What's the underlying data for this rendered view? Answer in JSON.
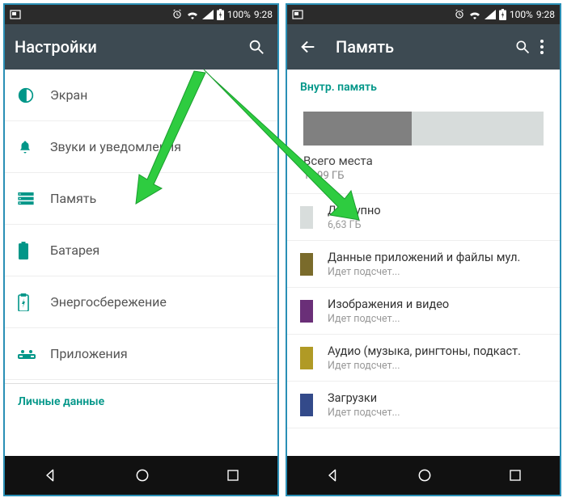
{
  "status": {
    "battery_pct": "100%",
    "time": "9:28"
  },
  "left": {
    "appbar_title": "Настройки",
    "items": [
      {
        "icon": "display-icon",
        "label": "Экран"
      },
      {
        "icon": "bell-icon",
        "label": "Звуки и уведомления"
      },
      {
        "icon": "storage-icon",
        "label": "Память"
      },
      {
        "icon": "battery-icon",
        "label": "Батарея"
      },
      {
        "icon": "battery-saver-icon",
        "label": "Энергосбережение"
      },
      {
        "icon": "apps-icon",
        "label": "Приложения"
      }
    ],
    "section_header": "Личные данные"
  },
  "right": {
    "appbar_title": "Память",
    "section_header": "Внутр. память",
    "used_fraction": 0.45,
    "summary_title": "Всего места",
    "summary_value": "11,99 ГБ",
    "categories": [
      {
        "swatch": "#d8dddc",
        "title": "Доступно",
        "value": "6,63 ГБ"
      },
      {
        "swatch": "#7a6b2b",
        "title": "Данные приложений и файлы мул.",
        "value": "Идет подсчет..."
      },
      {
        "swatch": "#6a2f78",
        "title": "Изображения и видео",
        "value": "Идет подсчет..."
      },
      {
        "swatch": "#b09a25",
        "title": "Аудио (музыка, рингтоны, подкаст.",
        "value": "Идет подсчет..."
      },
      {
        "swatch": "#334a8a",
        "title": "Загрузки",
        "value": "Идет подсчет..."
      }
    ]
  },
  "colors": {
    "accent": "#009688"
  }
}
